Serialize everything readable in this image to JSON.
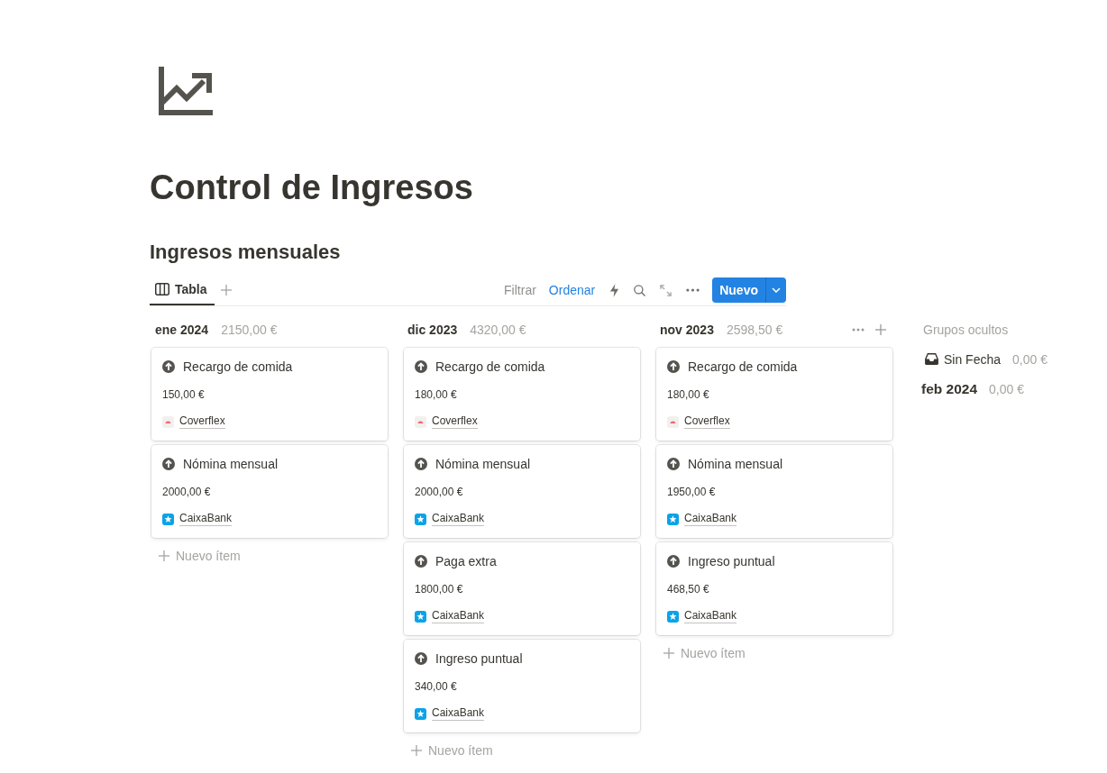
{
  "page": {
    "title": "Control de Ingresos"
  },
  "database": {
    "title": "Ingresos mensuales"
  },
  "views": [
    {
      "label": "Tabla",
      "selected": true
    }
  ],
  "toolbar": {
    "actions": [
      {
        "label": "Filtrar",
        "active": false
      },
      {
        "label": "Ordenar",
        "active": true
      }
    ],
    "new_button": "Nuevo"
  },
  "board": {
    "columns": [
      {
        "label": "ene 2024",
        "total": "2150,00 €",
        "hovered": false,
        "cards": [
          {
            "title": "Recargo de comida",
            "amount": "150,00 €",
            "account": {
              "name": "Coverflex",
              "kind": "dome"
            }
          },
          {
            "title": "Nómina mensual",
            "amount": "2000,00 €",
            "account": {
              "name": "CaixaBank",
              "kind": "star"
            }
          }
        ],
        "add_label": "Nuevo ítem"
      },
      {
        "label": "dic 2023",
        "total": "4320,00 €",
        "hovered": false,
        "cards": [
          {
            "title": "Recargo de comida",
            "amount": "180,00 €",
            "account": {
              "name": "Coverflex",
              "kind": "dome"
            }
          },
          {
            "title": "Nómina mensual",
            "amount": "2000,00 €",
            "account": {
              "name": "CaixaBank",
              "kind": "star"
            }
          },
          {
            "title": "Paga extra",
            "amount": "1800,00 €",
            "account": {
              "name": "CaixaBank",
              "kind": "star"
            }
          },
          {
            "title": "Ingreso puntual",
            "amount": "340,00 €",
            "account": {
              "name": "CaixaBank",
              "kind": "star"
            }
          }
        ],
        "add_label": "Nuevo ítem"
      },
      {
        "label": "nov 2023",
        "total": "2598,50 €",
        "hovered": true,
        "cards": [
          {
            "title": "Recargo de comida",
            "amount": "180,00 €",
            "account": {
              "name": "Coverflex",
              "kind": "dome"
            }
          },
          {
            "title": "Nómina mensual",
            "amount": "1950,00 €",
            "account": {
              "name": "CaixaBank",
              "kind": "star"
            }
          },
          {
            "title": "Ingreso puntual",
            "amount": "468,50 €",
            "account": {
              "name": "CaixaBank",
              "kind": "star"
            }
          }
        ],
        "add_label": "Nuevo ítem"
      }
    ],
    "hidden_groups": {
      "label": "Grupos ocultos",
      "items": [
        {
          "label": "Sin Fecha",
          "total": "0,00 €",
          "kind": "inbox"
        },
        {
          "label": "feb 2024",
          "total": "0,00 €",
          "kind": "month"
        }
      ]
    }
  }
}
